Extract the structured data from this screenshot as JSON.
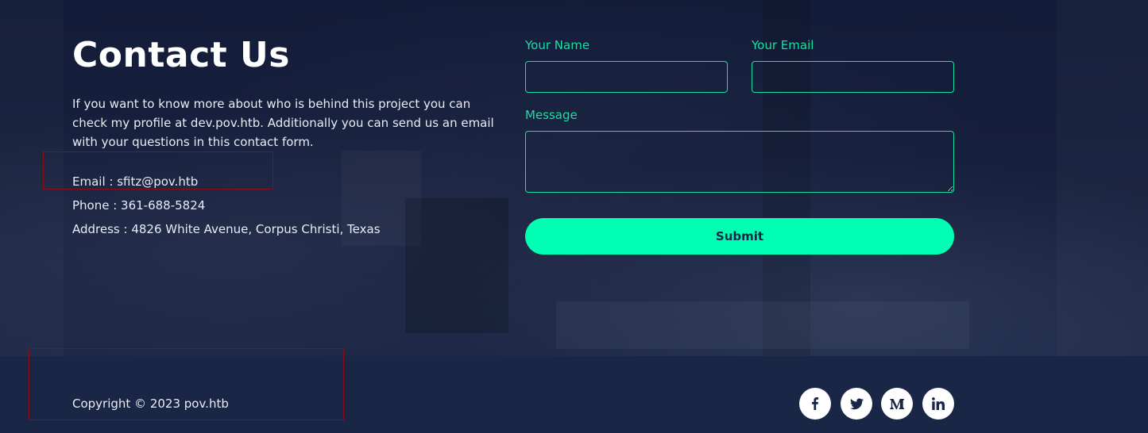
{
  "contact": {
    "heading": "Contact Us",
    "intro": "If you want to know more about who is behind this project you can check my profile at dev.pov.htb. Additionally you can send us an email with your questions in this contact form.",
    "email_line": "Email : sfitz@pov.htb",
    "phone_line": "Phone : 361-688-5824",
    "address_line": "Address : 4826 White Avenue, Corpus Christi, Texas"
  },
  "form": {
    "name_label": "Your Name",
    "name_value": "",
    "email_label": "Your Email",
    "email_value": "",
    "message_label": "Message",
    "message_value": "",
    "submit_label": "Submit"
  },
  "footer": {
    "copyright": "Copyright © 2023 pov.htb",
    "social": [
      {
        "icon": "facebook-icon"
      },
      {
        "icon": "twitter-icon"
      },
      {
        "icon": "medium-icon"
      },
      {
        "icon": "linkedin-icon"
      }
    ]
  },
  "colors": {
    "accent": "#14e2a4",
    "button": "#00ffb2",
    "background": "#1a2645",
    "annotation": "#8b0d18"
  }
}
